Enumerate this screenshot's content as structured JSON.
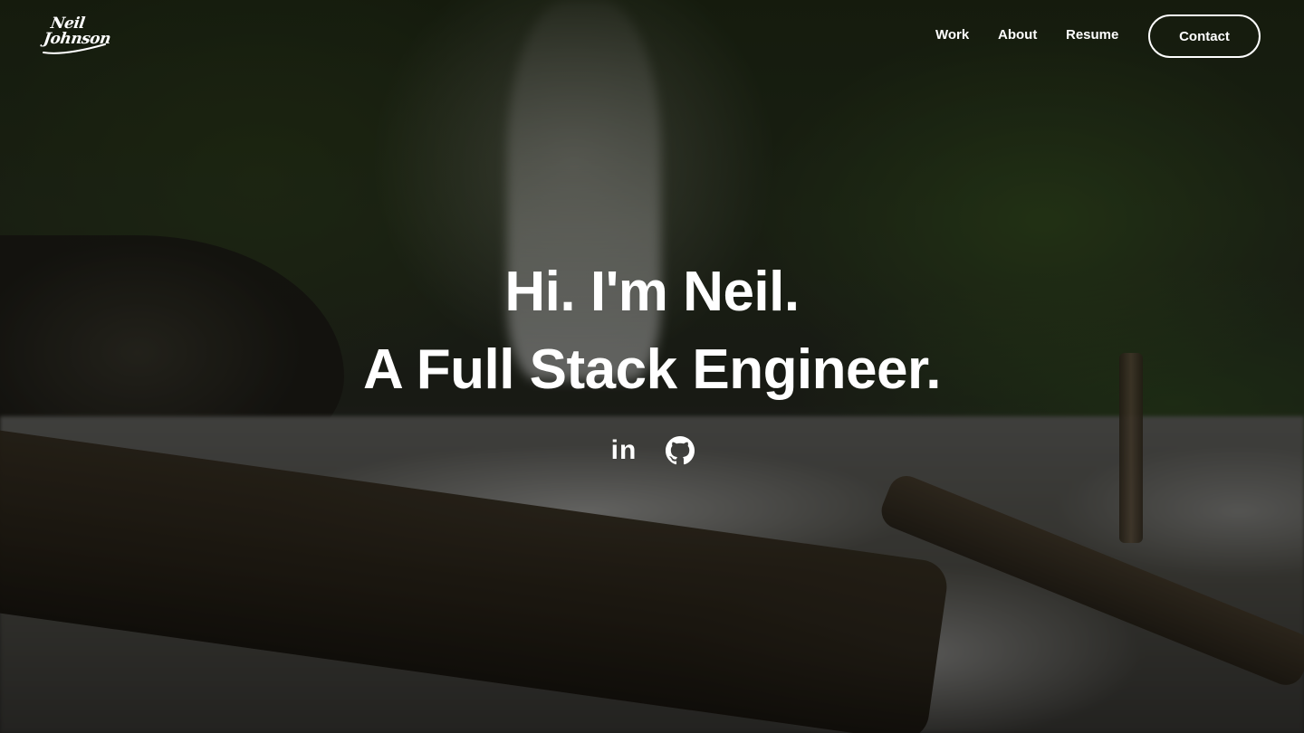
{
  "brand": {
    "logo_line1": "Neil",
    "logo_line2": "Johnson"
  },
  "nav": {
    "items": [
      {
        "label": "Work"
      },
      {
        "label": "About"
      },
      {
        "label": "Resume"
      }
    ],
    "contact_label": "Contact"
  },
  "hero": {
    "line1": "Hi. I'm Neil.",
    "line2": "A Full Stack Engineer.",
    "background_description": "forest waterfall with fallen log"
  },
  "socials": {
    "linkedin": {
      "label": "in",
      "icon": "linkedin-icon"
    },
    "github": {
      "icon": "github-icon"
    }
  },
  "colors": {
    "text": "#ffffff",
    "overlay": "#000000"
  }
}
